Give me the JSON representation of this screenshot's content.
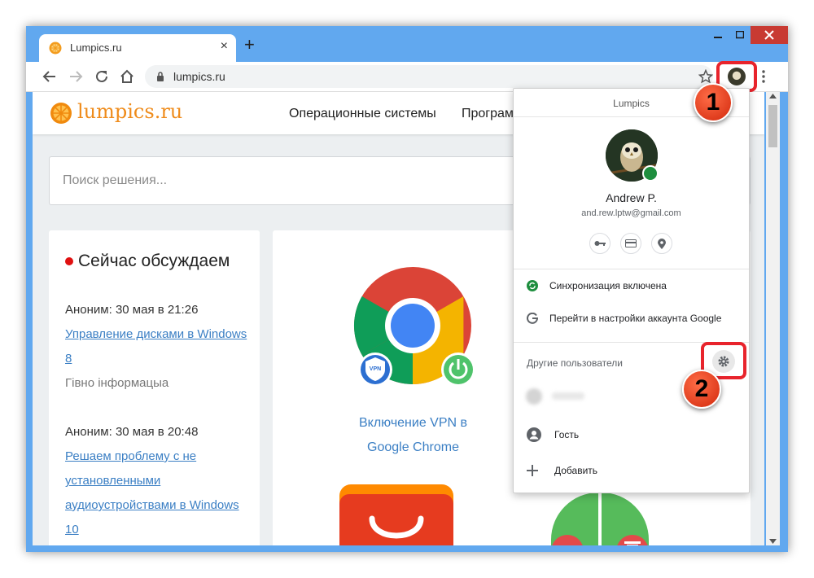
{
  "browser": {
    "tab_title": "Lumpics.ru",
    "tab_close": "×",
    "new_tab": "+",
    "url": "lumpics.ru",
    "icons": [
      "orange-favicon-icon",
      "back-icon",
      "forward-icon",
      "reload-icon",
      "home-icon",
      "lock-icon",
      "star-icon",
      "avatar",
      "kebab-icon",
      "minimize-icon",
      "maximize-icon",
      "close-icon"
    ],
    "colors": {
      "frame": "#61a8ef",
      "close": "#c83a32",
      "highlight": "#e8242c"
    }
  },
  "site": {
    "logo": "lumpics.ru",
    "nav": [
      "Операционные системы",
      "Програм"
    ],
    "search_placeholder": "Поиск решения...",
    "discussing": {
      "title": "Сейчас обсуждаем",
      "comments": [
        {
          "meta": "Аноним: 30 мая в 21:26",
          "link": "Управление дисками в Windows 8",
          "note": "Гівно інформацыа"
        },
        {
          "meta": "Аноним: 30 мая в 20:48",
          "link": "Решаем проблему с не установленными аудиоустройствами в Windows 10"
        }
      ]
    },
    "article": {
      "title": "Включение VPN в Google Chrome",
      "vpn_badge": "VPN"
    }
  },
  "profile_menu": {
    "header": "Lumpics",
    "name": "Andrew P.",
    "email": "and.rew.lptw@gmail.com",
    "quick_icons": [
      "key-icon",
      "card-icon",
      "location-icon"
    ],
    "sync": "Синхронизация включена",
    "google_settings": "Перейти в настройки аккаунта Google",
    "other_users": "Другие пользователи",
    "guest": "Гость",
    "add": "Добавить"
  },
  "callouts": {
    "first": "1",
    "second": "2"
  }
}
